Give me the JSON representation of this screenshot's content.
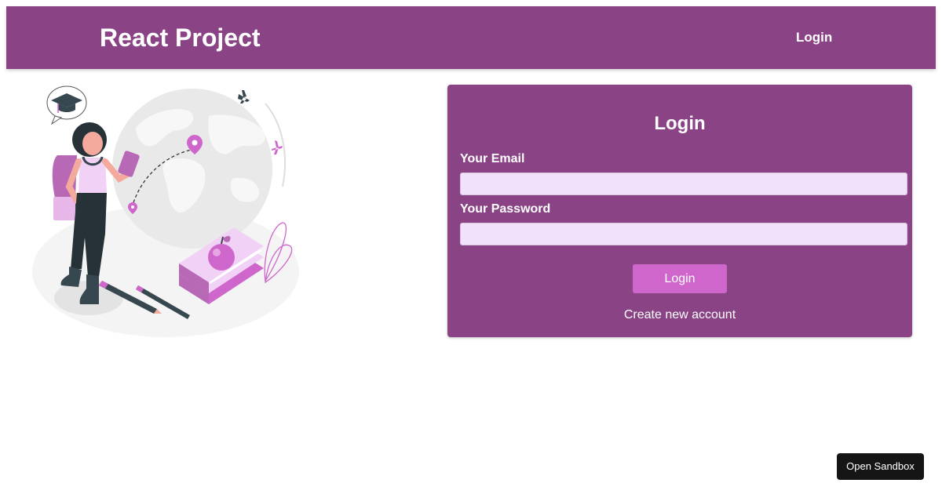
{
  "header": {
    "brand": "React Project",
    "nav_login": "Login",
    "background_color": "#8a4486"
  },
  "illustration": {
    "icon": "student-globe-illustration",
    "accent_color": "#cf66cc"
  },
  "login_form": {
    "title": "Login",
    "email_label": "Your Email",
    "email_value": "",
    "email_placeholder": "",
    "password_label": "Your Password",
    "password_value": "",
    "password_placeholder": "",
    "submit_label": "Login",
    "create_account_label": "Create new account",
    "card_color": "#8a4486",
    "input_color": "#f1e1fa",
    "button_color": "#cf66cc"
  },
  "sandbox": {
    "label": "Open Sandbox"
  }
}
